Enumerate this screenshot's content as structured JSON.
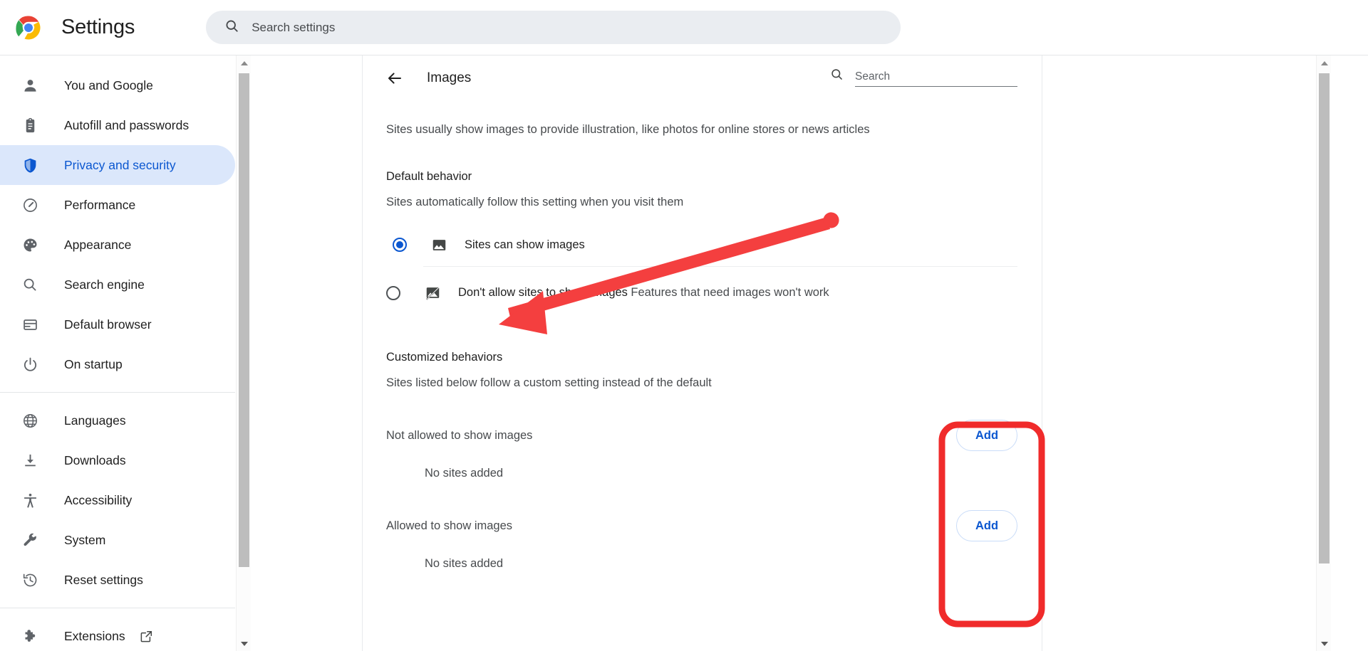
{
  "app": {
    "title": "Settings",
    "logo_icon": "chrome-logo-icon"
  },
  "search": {
    "icon": "search-icon",
    "placeholder": "Search settings",
    "value": ""
  },
  "sidebar": {
    "groups": [
      {
        "items": [
          {
            "label": "You and Google",
            "icon": "person-icon",
            "active": false
          },
          {
            "label": "Autofill and passwords",
            "icon": "clipboard-icon",
            "active": false
          },
          {
            "label": "Privacy and security",
            "icon": "shield-icon",
            "active": true
          },
          {
            "label": "Performance",
            "icon": "speedometer-icon",
            "active": false
          },
          {
            "label": "Appearance",
            "icon": "palette-icon",
            "active": false
          },
          {
            "label": "Search engine",
            "icon": "search-icon",
            "active": false
          },
          {
            "label": "Default browser",
            "icon": "browser-window-icon",
            "active": false
          },
          {
            "label": "On startup",
            "icon": "power-icon",
            "active": false
          }
        ]
      },
      {
        "items": [
          {
            "label": "Languages",
            "icon": "globe-icon",
            "active": false
          },
          {
            "label": "Downloads",
            "icon": "download-icon",
            "active": false
          },
          {
            "label": "Accessibility",
            "icon": "accessibility-icon",
            "active": false
          },
          {
            "label": "System",
            "icon": "wrench-icon",
            "active": false
          },
          {
            "label": "Reset settings",
            "icon": "history-restore-icon",
            "active": false
          }
        ]
      },
      {
        "items": [
          {
            "label": "Extensions",
            "icon": "puzzle-piece-icon",
            "active": false,
            "external": true,
            "external_icon": "open-in-new-icon"
          }
        ]
      }
    ]
  },
  "main": {
    "back_icon": "arrow-left-icon",
    "title": "Images",
    "search": {
      "icon": "search-icon",
      "placeholder": "Search",
      "value": ""
    },
    "intro": "Sites usually show images to provide illustration, like photos for online stores or news articles",
    "default_behavior": {
      "title": "Default behavior",
      "subtitle": "Sites automatically follow this setting when you visit them",
      "options": [
        {
          "label": "Sites can show images",
          "sublabel": "",
          "icon": "image-icon",
          "selected": true
        },
        {
          "label": "Don't allow sites to show images",
          "sublabel": "Features that need images won't work",
          "icon": "image-blocked-icon",
          "selected": false
        }
      ]
    },
    "customized_behaviors": {
      "title": "Customized behaviors",
      "subtitle": "Sites listed below follow a custom setting instead of the default",
      "lists": [
        {
          "label": "Not allowed to show images",
          "add_label": "Add",
          "empty_text": "No sites added"
        },
        {
          "label": "Allowed to show images",
          "add_label": "Add",
          "empty_text": "No sites added"
        }
      ]
    }
  },
  "annotations": {
    "arrow": {
      "name": "red-arrow-annotation",
      "color": "#f43f3f"
    },
    "highlight_box": {
      "name": "red-highlight-box-annotation",
      "color": "#f02b2b"
    }
  },
  "colors": {
    "accent_blue": "#0b57d0",
    "active_nav_bg": "#dbe7fb",
    "search_bg": "#eaedf1",
    "annotation_red": "#f43f3f",
    "text_primary": "#1f1f1f",
    "text_secondary": "#474a4d"
  },
  "scrollbars": {
    "sidebar": {
      "up_icon": "triangle-up-icon",
      "down_icon": "triangle-down-icon"
    },
    "content": {
      "up_icon": "triangle-up-icon",
      "down_icon": "triangle-down-icon"
    }
  }
}
